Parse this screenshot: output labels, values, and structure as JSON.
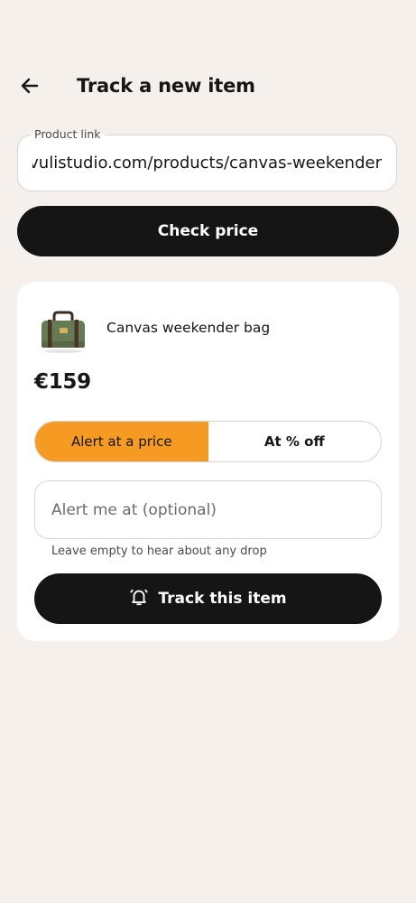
{
  "header": {
    "title": "Track a new item",
    "back_icon": "arrow-left-icon"
  },
  "url_field": {
    "label": "Product link",
    "value": "kivulistudio.com/products/canvas-weekender"
  },
  "check_button": {
    "label": "Check price"
  },
  "product": {
    "name": "Canvas weekender bag",
    "price": "€159",
    "image_icon": "bag-icon"
  },
  "alert_mode": {
    "options": [
      "Alert at a price",
      "At % off"
    ],
    "selected": "Alert at a price"
  },
  "alert_input": {
    "placeholder": "Alert me at (optional)",
    "value": "",
    "hint": "Leave empty to hear about any drop"
  },
  "track_button": {
    "label": "Track this item",
    "icon": "bell-icon"
  },
  "colors": {
    "background": "#f5f0ec",
    "accent": "#f59a23",
    "button": "#151515",
    "card": "#ffffff"
  }
}
